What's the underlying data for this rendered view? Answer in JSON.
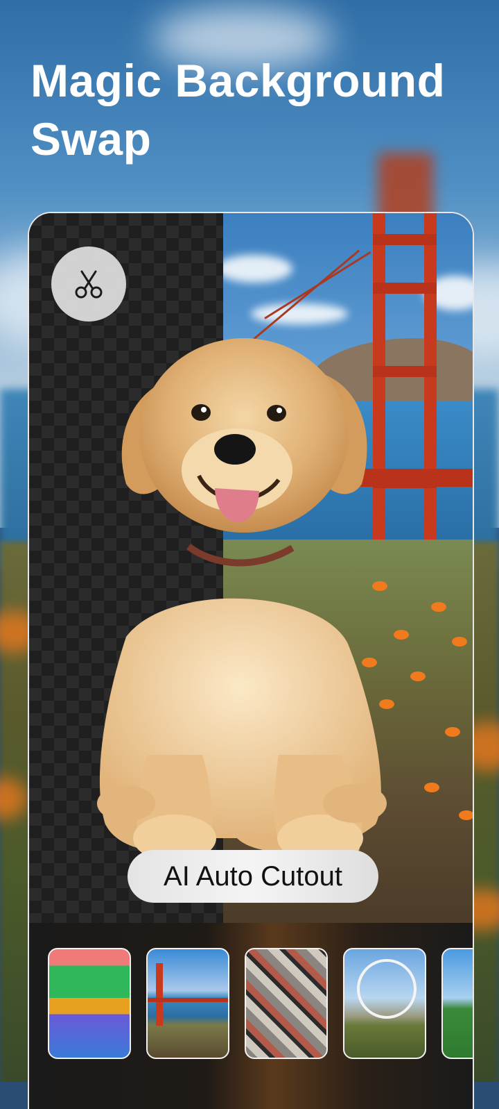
{
  "headline": "Magic Background Swap",
  "cutout_button": {
    "icon": "scissors-icon"
  },
  "feature_label": "AI Auto Cutout",
  "background_thumbnails": [
    {
      "name": "tropical-palms-thumbnail"
    },
    {
      "name": "golden-gate-thumbnail"
    },
    {
      "name": "vintage-posters-thumbnail"
    },
    {
      "name": "ferris-wheel-thumbnail"
    },
    {
      "name": "green-field-thumbnail"
    }
  ],
  "colors": {
    "accent_white": "#ffffff",
    "pill_text": "#111111",
    "bridge_red": "#c73a1d"
  }
}
